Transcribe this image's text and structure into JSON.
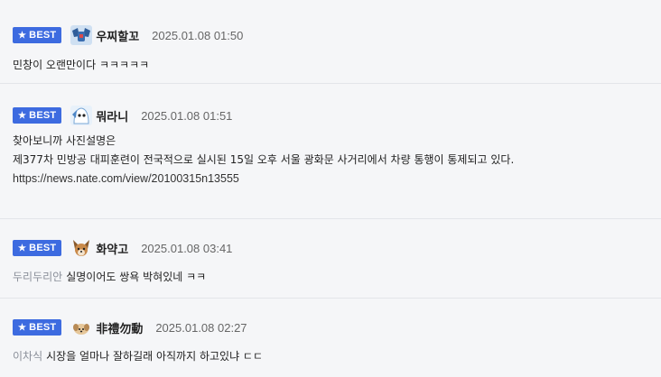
{
  "badge_label": "BEST",
  "comments": [
    {
      "nickname": "우찌할꼬",
      "time": "2025.01.08 01:50",
      "lines": [
        "민창이 오랜만이다 ㅋㅋㅋㅋㅋ"
      ],
      "avatar_icon": "robot-avatar-icon"
    },
    {
      "nickname": "뭐라니",
      "time": "2025.01.08 01:51",
      "lines": [
        "찾아보니까 사진설명은",
        "제377차 민방공 대피훈련이 전국적으로 실시된 15일 오후 서울 광화문 사거리에서 차량 통행이 통제되고 있다.",
        "https://news.nate.com/view/20100315n13555"
      ],
      "avatar_icon": "ghost-avatar-icon"
    },
    {
      "nickname": "화약고",
      "time": "2025.01.08 03:41",
      "reply_to": "두리두리안",
      "lines": [
        "실명이어도 쌍욕 박혀있네 ㅋㅋ"
      ],
      "avatar_icon": "dog-avatar-icon"
    },
    {
      "nickname": "非禮勿動",
      "time": "2025.01.08 02:27",
      "reply_to": "이차식",
      "lines": [
        "시장을 얼마나 잘하길래 아직까지 하고있냐 ㄷㄷ"
      ],
      "avatar_icon": "puppy-avatar-icon"
    }
  ],
  "colors": {
    "badge": "#3d6be0",
    "background": "#f5f6f8",
    "reply_to": "#8a8f99"
  }
}
